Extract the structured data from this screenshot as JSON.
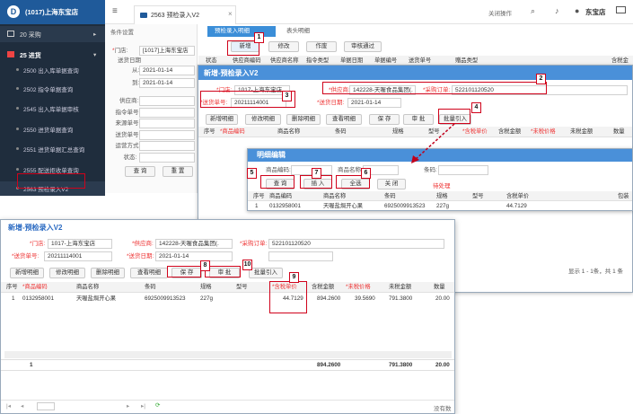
{
  "app": {
    "store": "(1017)上海东宝店",
    "store_header": "东宝店",
    "close_ops": "关闭操作",
    "tab": "2563 预检录入V2"
  },
  "sidebar": {
    "items": [
      {
        "label": "20 采购"
      },
      {
        "label": "25 进货"
      },
      {
        "label": "2500 出入库单据查询"
      },
      {
        "label": "2502 指令单据查询"
      },
      {
        "label": "2545 出入库单据审核"
      },
      {
        "label": "2550 进货单据查询"
      },
      {
        "label": "2551 进货单据汇总查询"
      },
      {
        "label": "2555 配送拒收单查询"
      },
      {
        "label": "2563 预检录入V2"
      }
    ]
  },
  "filter": {
    "title": "条件设置",
    "store_label": "*门店:",
    "store_value": "[1017]上海东宝店",
    "date_label": "送货日期",
    "from_label": "从:",
    "from_value": "2021-01-14",
    "to_label": "到:",
    "to_value": "2021-01-14",
    "fields": [
      "供应商:",
      "指令单号:",
      "来源单号:",
      "送货单号:",
      "运营方式:",
      "状态:"
    ],
    "query": "查 询",
    "reset": "重 置"
  },
  "bg_main": {
    "tabs": [
      "预检录入明细",
      "表头明细"
    ],
    "buttons": [
      "新增",
      "修改",
      "作废",
      "审核通过"
    ],
    "cols": [
      "状态",
      "供应商编码",
      "供应商名称",
      "指令类型",
      "单据日期",
      "单据编号",
      "送货单号",
      "赠品类型",
      "含税金"
    ]
  },
  "new_win": {
    "title": "新增-预检录入V2",
    "store_label": "*门店:",
    "store_value": "1017-上海东宝店",
    "supplier_label": "*供应商:",
    "supplier_value": "142228-天喔食品集团(.",
    "po_label": "*采购订单:",
    "po_value": "522101120520",
    "delivery_label": "*送货单号:",
    "delivery_value": "20211114001",
    "ddate_label": "*送货日期:",
    "ddate_value": "2021-01-14",
    "buttons": [
      "新增明细",
      "修改明细",
      "删除明细",
      "查看明细",
      "保 存",
      "审 批",
      "批量引入"
    ],
    "cols": [
      "序号",
      "*商品编码",
      "商品名称",
      "条码",
      "规格",
      "型号",
      "*含税单价",
      "含税金额",
      "*未税价格",
      "未税金额",
      "数量"
    ]
  },
  "detail": {
    "title": "明细编辑",
    "code_label": "商品编码:",
    "name_label": "商品名称:",
    "bar_label": "条码:",
    "buttons": [
      "查 询",
      "插 入",
      "全选",
      "关 闭"
    ],
    "pending": "待处理",
    "cols": [
      "序号",
      "商品编码",
      "商品名称",
      "条码",
      "规格",
      "型号",
      "含税单价",
      "包装"
    ],
    "row": [
      "1",
      "0132958001",
      "天喔盐焗开心果",
      "6925009913523",
      "227g",
      "",
      "44.7129"
    ],
    "pager": "显示 1 - 1条，共 1 条"
  },
  "front": {
    "row": {
      "no": "1",
      "code": "0132958001",
      "name": "天喔盐焗开心果",
      "bar": "6925009913523",
      "spec": "227g",
      "price": "44.7129",
      "amount": "894.2600",
      "untaxed": "39.5690",
      "untaxed_amt": "791.3800",
      "qty": "20.00"
    },
    "sum": {
      "no": "1",
      "amount": "894.2600",
      "untaxed_amt": "791.3800",
      "qty": "20.00"
    },
    "no_data": "没有数"
  },
  "badges": [
    "1",
    "2",
    "3",
    "4",
    "5",
    "6",
    "7",
    "8",
    "9",
    "10"
  ],
  "colors": {
    "nav": "#1f2d3d",
    "accent": "#3b8ed8",
    "title_bar": "#4a90d9",
    "annot": "#d0021b"
  }
}
